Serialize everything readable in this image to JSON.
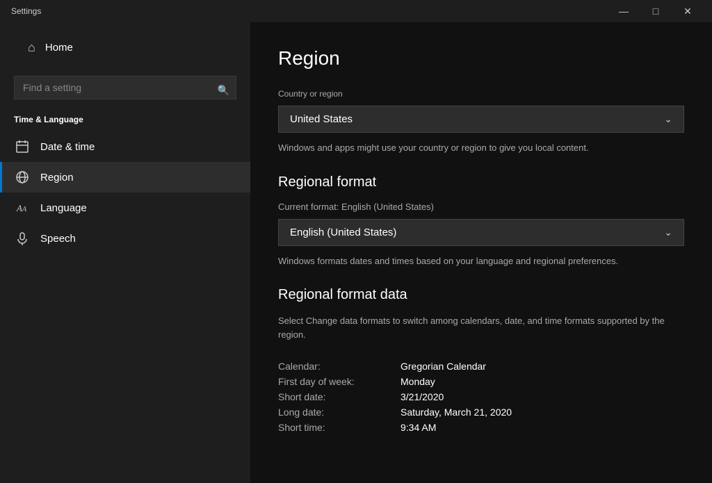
{
  "titleBar": {
    "title": "Settings",
    "minimize": "—",
    "restore": "□",
    "close": "✕"
  },
  "sidebar": {
    "appTitle": "Settings",
    "homeLabel": "Home",
    "searchPlaceholder": "Find a setting",
    "sectionLabel": "Time & Language",
    "navItems": [
      {
        "id": "date-time",
        "label": "Date & time",
        "icon": "📅",
        "active": false
      },
      {
        "id": "region",
        "label": "Region",
        "icon": "🌐",
        "active": true
      },
      {
        "id": "language",
        "label": "Language",
        "icon": "A",
        "active": false
      },
      {
        "id": "speech",
        "label": "Speech",
        "icon": "🎤",
        "active": false
      }
    ]
  },
  "content": {
    "pageTitle": "Region",
    "countrySection": {
      "label": "Country or region",
      "selected": "United States",
      "helpText": "Windows and apps might use your country or region to give you local content."
    },
    "regionalFormat": {
      "heading": "Regional format",
      "currentFormatLabel": "Current format: English (United States)",
      "selected": "English (United States)",
      "helpText": "Windows formats dates and times based on your language and regional preferences."
    },
    "regionalFormatData": {
      "heading": "Regional format data",
      "description": "Select Change data formats to switch among calendars, date, and time formats supported by the region.",
      "items": [
        {
          "key": "Calendar:",
          "value": "Gregorian Calendar"
        },
        {
          "key": "First day of week:",
          "value": "Monday"
        },
        {
          "key": "Short date:",
          "value": "3/21/2020"
        },
        {
          "key": "Long date:",
          "value": "Saturday, March 21, 2020"
        },
        {
          "key": "Short time:",
          "value": "9:34 AM"
        }
      ]
    }
  }
}
